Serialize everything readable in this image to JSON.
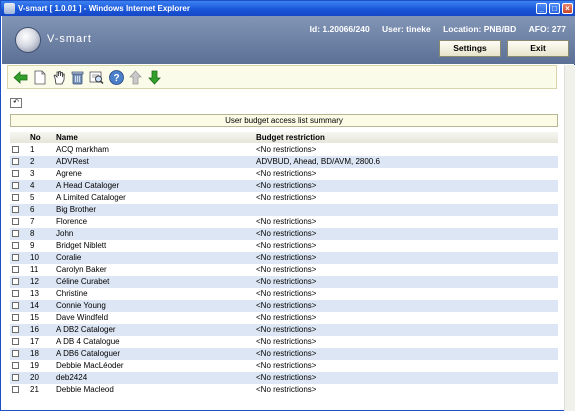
{
  "window": {
    "title": "V-smart [ 1.0.01 ] - Windows Internet Explorer"
  },
  "header": {
    "logo_text": "V-smart",
    "id_label": "Id: 1.20066/240",
    "user_label": "User: tineke",
    "location_label": "Location: PNB/BD",
    "afo_label": "AFO: 277",
    "settings_label": "Settings",
    "exit_label": "Exit"
  },
  "toolbar": {
    "icons": [
      "back-arrow-icon",
      "new-document-icon",
      "hand-select-icon",
      "delete-trash-icon",
      "search-view-icon",
      "help-icon",
      "move-up-icon",
      "move-down-icon"
    ]
  },
  "summary_title": "User budget access list summary",
  "table": {
    "columns": [
      "No",
      "Name",
      "Budget restriction"
    ],
    "rows": [
      {
        "no": "1",
        "name": "ACQ markham",
        "restriction": "<No restrictions>"
      },
      {
        "no": "2",
        "name": "ADVRest",
        "restriction": "ADVBUD, Ahead, BD/AVM, 2800.6"
      },
      {
        "no": "3",
        "name": "Agrene",
        "restriction": "<No restrictions>"
      },
      {
        "no": "4",
        "name": "A Head Cataloger",
        "restriction": "<No restrictions>"
      },
      {
        "no": "5",
        "name": "A Limited Cataloger",
        "restriction": "<No restrictions>"
      },
      {
        "no": "6",
        "name": "Big Brother",
        "restriction": ""
      },
      {
        "no": "7",
        "name": "Florence",
        "restriction": "<No restrictions>"
      },
      {
        "no": "8",
        "name": "John",
        "restriction": "<No restrictions>"
      },
      {
        "no": "9",
        "name": "Bridget Niblett",
        "restriction": "<No restrictions>"
      },
      {
        "no": "10",
        "name": "Coralie",
        "restriction": "<No restrictions>"
      },
      {
        "no": "11",
        "name": "Carolyn Baker",
        "restriction": "<No restrictions>"
      },
      {
        "no": "12",
        "name": "Céline Curabet",
        "restriction": "<No restrictions>"
      },
      {
        "no": "13",
        "name": "Christine",
        "restriction": "<No restrictions>"
      },
      {
        "no": "14",
        "name": "Connie Young",
        "restriction": "<No restrictions>"
      },
      {
        "no": "15",
        "name": "Dave Windfeld",
        "restriction": "<No restrictions>"
      },
      {
        "no": "16",
        "name": "A DB2 Cataloger",
        "restriction": "<No restrictions>"
      },
      {
        "no": "17",
        "name": "A DB 4 Catalogue",
        "restriction": "<No restrictions>"
      },
      {
        "no": "18",
        "name": "A DB6 Cataloguer",
        "restriction": "<No restrictions>"
      },
      {
        "no": "19",
        "name": "Debbie MacLéoder",
        "restriction": "<No restrictions>"
      },
      {
        "no": "20",
        "name": "deb2424",
        "restriction": "<No restrictions>"
      },
      {
        "no": "21",
        "name": "Debbie Macleod",
        "restriction": "<No restrictions>"
      }
    ]
  }
}
